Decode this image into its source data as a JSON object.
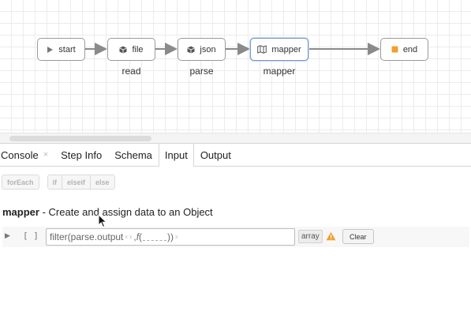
{
  "flow": {
    "nodes": [
      {
        "id": "start",
        "label": "start",
        "sublabel": "",
        "icon": "play-icon"
      },
      {
        "id": "file",
        "label": "file",
        "sublabel": "read",
        "icon": "cube-icon"
      },
      {
        "id": "json",
        "label": "json",
        "sublabel": "parse",
        "icon": "cube-icon"
      },
      {
        "id": "mapper",
        "label": "mapper",
        "sublabel": "mapper",
        "icon": "map-icon",
        "selected": true
      },
      {
        "id": "end",
        "label": "end",
        "sublabel": "",
        "icon": "stop-icon"
      }
    ],
    "colors": {
      "edge": "#8a8a8a",
      "end_icon": "#f0a030",
      "selected_border": "#7b98c4"
    }
  },
  "tabs": [
    {
      "label": "Console",
      "closable": true,
      "close_glyph": "×"
    },
    {
      "label": "Step Info"
    },
    {
      "label": "Schema"
    },
    {
      "label": "Input",
      "active": true
    },
    {
      "label": "Output"
    }
  ],
  "toolbar": {
    "foreach_label": "forEach",
    "if_label": "if",
    "elseif_label": "elseif",
    "else_label": "else"
  },
  "mapper": {
    "name": "mapper",
    "description": "- Create and assign data to an Object"
  },
  "expression": {
    "expand_glyph": "▶",
    "array_glyph": "[ ]",
    "fn_name": "filter",
    "open_paren": "(",
    "arg1": "parse.output",
    "arg1_hint": "x x",
    "comma": ",",
    "arg2_fn": "f",
    "arg2_open": "(",
    "arg2_close": ")",
    "close_paren": ")",
    "trailing_hint": "x",
    "type_label": "array",
    "clear_label": "Clear",
    "warn_color": "#f0a030"
  }
}
